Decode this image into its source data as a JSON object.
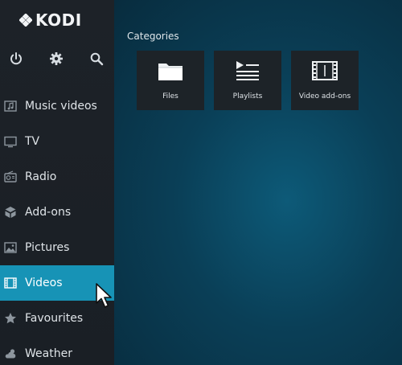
{
  "app": {
    "logo_text": "KODI",
    "accent_color": "#1793b6",
    "sidebar_bg": "#1d2228",
    "main_bg": "#0b3a50"
  },
  "top_icons": [
    {
      "name": "power-icon"
    },
    {
      "name": "gear-icon"
    },
    {
      "name": "search-icon"
    }
  ],
  "sidebar": {
    "items": [
      {
        "label": "Music videos",
        "icon": "music-video-icon",
        "active": false
      },
      {
        "label": "TV",
        "icon": "tv-icon",
        "active": false
      },
      {
        "label": "Radio",
        "icon": "radio-icon",
        "active": false
      },
      {
        "label": "Add-ons",
        "icon": "addons-icon",
        "active": false
      },
      {
        "label": "Pictures",
        "icon": "pictures-icon",
        "active": false
      },
      {
        "label": "Videos",
        "icon": "film-icon",
        "active": true
      },
      {
        "label": "Favourites",
        "icon": "star-icon",
        "active": false
      },
      {
        "label": "Weather",
        "icon": "weather-icon",
        "active": false
      }
    ]
  },
  "main": {
    "section_title": "Categories",
    "tiles": [
      {
        "label": "Files",
        "icon": "folder-icon"
      },
      {
        "label": "Playlists",
        "icon": "playlist-icon"
      },
      {
        "label": "Video add-ons",
        "icon": "film-strip-icon"
      }
    ]
  }
}
